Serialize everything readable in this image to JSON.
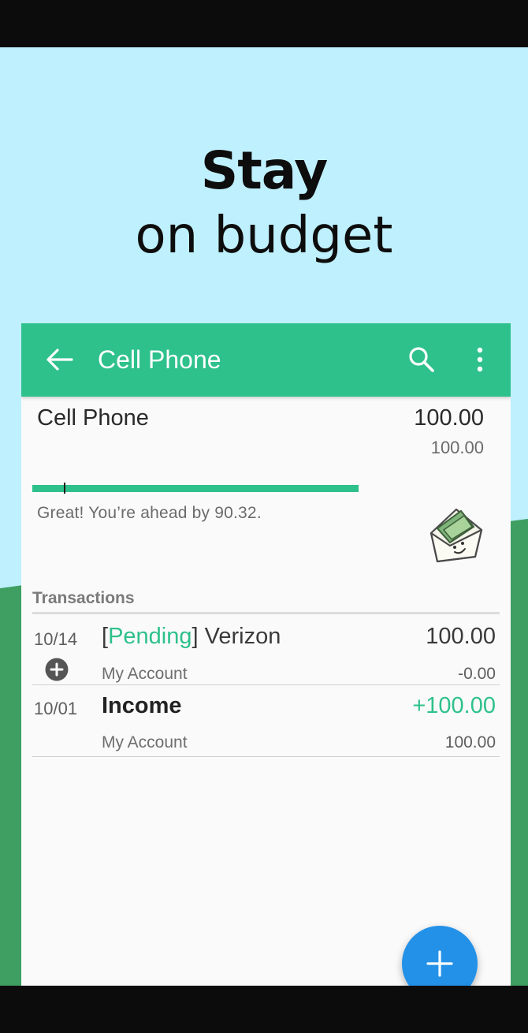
{
  "promo": {
    "headline_bold": "Stay",
    "headline_regular": "on budget"
  },
  "appbar": {
    "title": "Cell Phone",
    "back_icon": "arrow-back-icon",
    "search_icon": "search-icon",
    "more_icon": "more-vert-icon"
  },
  "envelope": {
    "name": "Cell Phone",
    "amount": "100.00",
    "budget": "100.00",
    "status": "Great! You’re ahead by 90.32.",
    "progress_fraction": 1.0,
    "icon": "envelope-money-icon"
  },
  "transactions": {
    "section_title": "Transactions",
    "items": [
      {
        "date": "10/14",
        "pending_open": "[",
        "pending_label": "Pending",
        "pending_close": "]",
        "payee": " Verizon",
        "amount": "100.00",
        "account": "My Account",
        "sub_amount": "-0.00",
        "icon": "add-circle-icon"
      },
      {
        "date": "10/01",
        "payee": "Income",
        "amount": "+100.00",
        "account": "My Account",
        "sub_amount": "100.00"
      }
    ]
  },
  "fab": {
    "icon": "plus-icon"
  },
  "colors": {
    "brand_green": "#2ec18b",
    "sky": "#bff0fd",
    "hill_green": "#3f9f62",
    "fab_blue": "#2391e8"
  }
}
